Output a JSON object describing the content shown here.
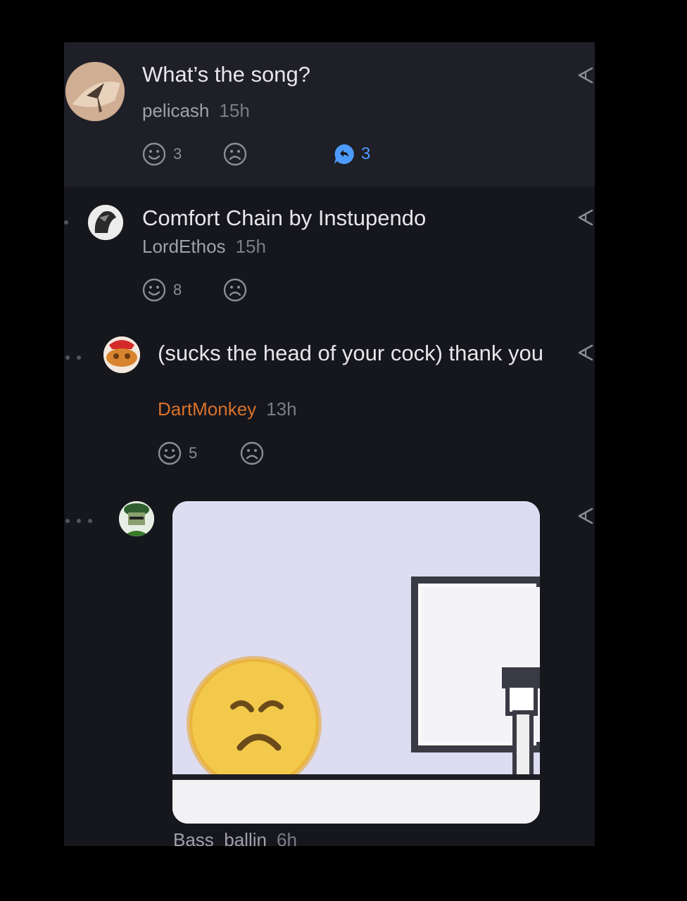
{
  "comments": [
    {
      "text": "What’s the song?",
      "author": "pelicash",
      "time": "15h",
      "likes": "3",
      "replies": "3"
    },
    {
      "text": "Comfort Chain by Instupendo",
      "author": "LordEthos",
      "time": "15h",
      "likes": "8"
    },
    {
      "text": "(sucks the head of your cock) thank you",
      "author": "DartMonkey",
      "time": "13h",
      "likes": "5"
    },
    {
      "author": "Bass_ballin",
      "time": "6h",
      "image_icon": "frowning-emoji-at-computer-meme"
    }
  ],
  "icons": {
    "like": "smile-face-icon",
    "dislike": "frown-face-icon",
    "reply": "reply-bubble-icon",
    "share": "share-icon"
  },
  "colors": {
    "panel": "#16161d",
    "highlight": "#1f1f27",
    "reply_accent": "#4e9bff",
    "author_accent": "#d8722a"
  }
}
